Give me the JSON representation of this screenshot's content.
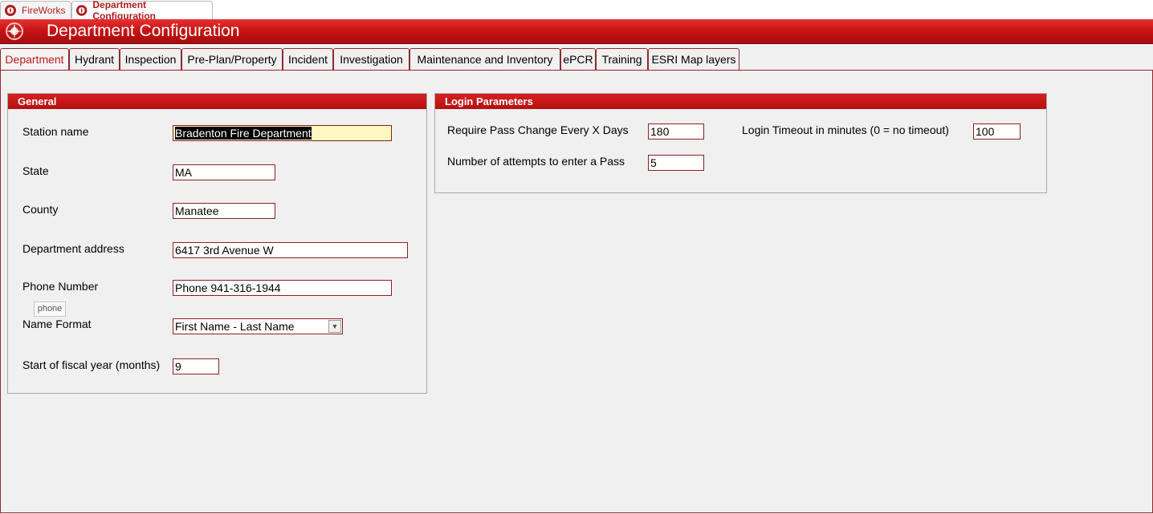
{
  "doc_tabs": [
    {
      "label": "FireWorks",
      "icon": "fire-department-logo-icon"
    },
    {
      "label": "Department Configuration",
      "icon": "fire-department-logo-icon"
    }
  ],
  "header": {
    "title": "Department Configuration",
    "logo": "fire-department-logo-icon"
  },
  "form_tabs": [
    "Department",
    "Hydrant",
    "Inspection",
    "Pre-Plan/Property",
    "Incident",
    "Investigation",
    "Maintenance and Inventory",
    "ePCR",
    "Training",
    "ESRI Map layers"
  ],
  "active_tab": "Department",
  "general": {
    "title": "General",
    "station_name_label": "Station name",
    "station_name_value": "Bradenton Fire Department",
    "state_label": "State",
    "state_value": "MA",
    "county_label": "County",
    "county_value": "Manatee",
    "address_label": "Department address",
    "address_value": "6417 3rd Avenue W",
    "phone_label": "Phone Number",
    "phone_value": "Phone 941-316-1944",
    "phone_tooltip": "phone",
    "name_format_label": "Name Format",
    "name_format_value": "First Name - Last Name",
    "fiscal_label": "Start of fiscal year (months)",
    "fiscal_value": "9"
  },
  "login": {
    "title": "Login Parameters",
    "pass_change_label": "Require Pass Change Every X Days",
    "pass_change_value": "180",
    "attempts_label": "Number of attempts to enter a Pass",
    "attempts_value": "5",
    "timeout_label": "Login Timeout in minutes (0 = no timeout)",
    "timeout_value": "100"
  },
  "colors": {
    "accent": "#c81414",
    "border": "#8f2a2a",
    "highlight_field": "#fff8c0"
  }
}
